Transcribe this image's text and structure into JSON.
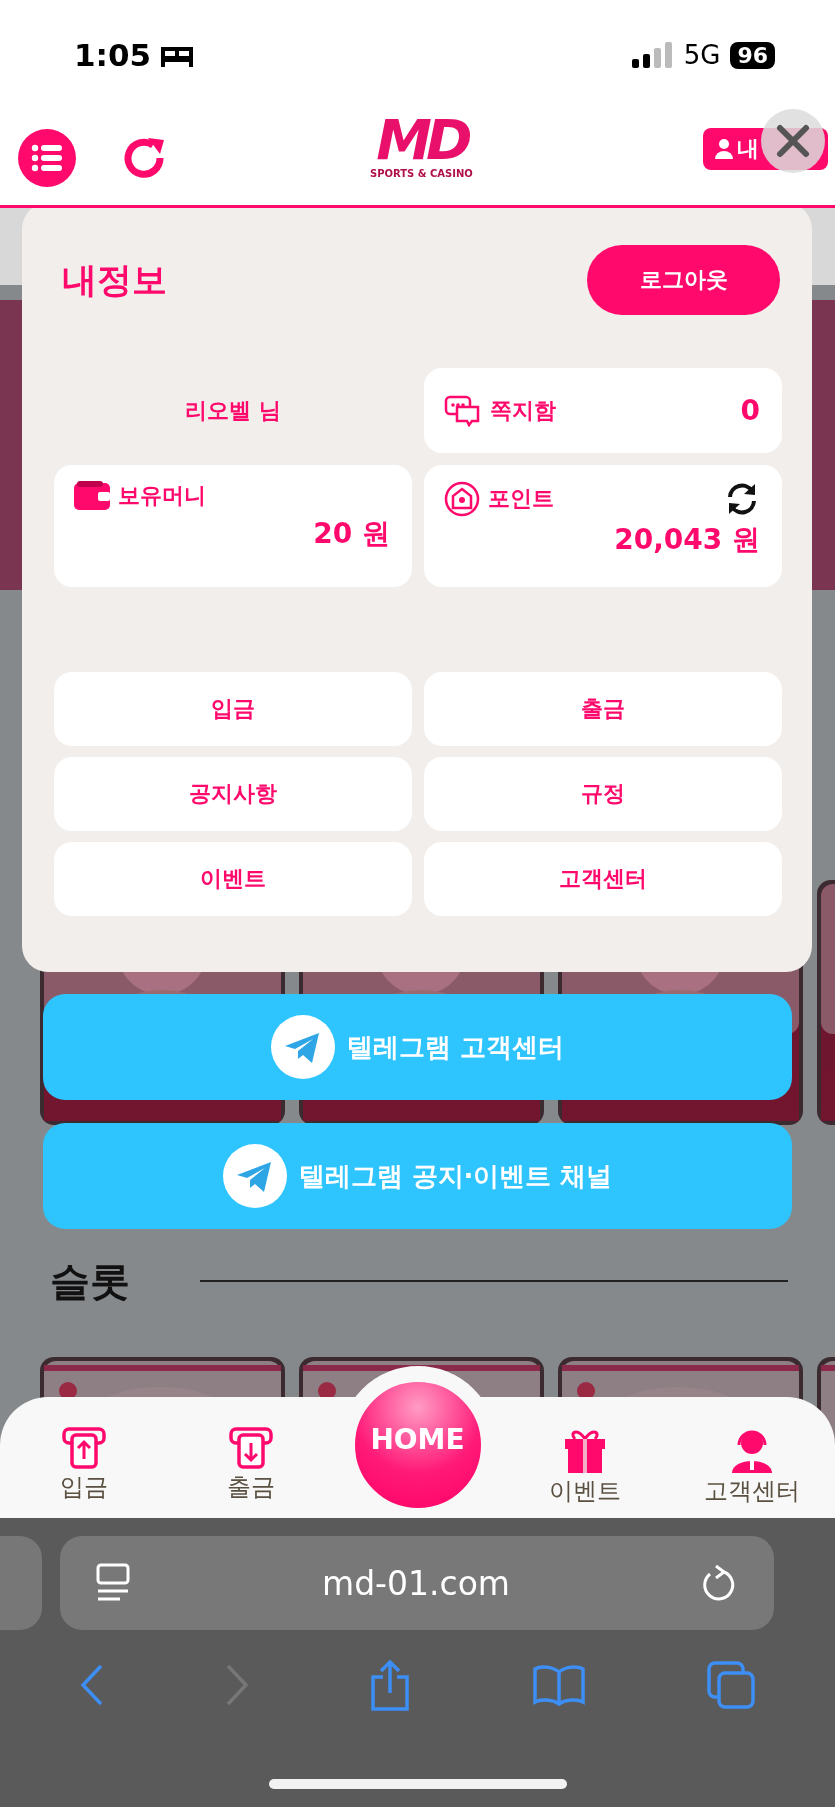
{
  "status_bar": {
    "time": "1:05",
    "network": "5G",
    "battery": "96"
  },
  "header": {
    "logo_mark": "MD",
    "logo_text": "SPORTS & CASINO",
    "account_button": "내"
  },
  "modal": {
    "title": "내정보",
    "logout": "로그아웃",
    "user": "리오벨 님",
    "messages": {
      "label": "쪽지함",
      "count": "0"
    },
    "money": {
      "label": "보유머니",
      "value": "20 원"
    },
    "points": {
      "label": "포인트",
      "value": "20,043 원"
    },
    "menu": [
      "입금",
      "출금",
      "공지사항",
      "규정",
      "이벤트",
      "고객센터"
    ]
  },
  "telegram_buttons": [
    "텔레그램 고객센터",
    "텔레그램 공지·이벤트 채널"
  ],
  "section_title": "슬롯",
  "bottom_nav": [
    {
      "label": "입금",
      "kind": "deposit"
    },
    {
      "label": "출금",
      "kind": "withdraw"
    },
    {
      "label": "HOME",
      "kind": "home"
    },
    {
      "label": "이벤트",
      "kind": "gift"
    },
    {
      "label": "고객센터",
      "kind": "support"
    }
  ],
  "browser": {
    "url": "md-01.com"
  }
}
